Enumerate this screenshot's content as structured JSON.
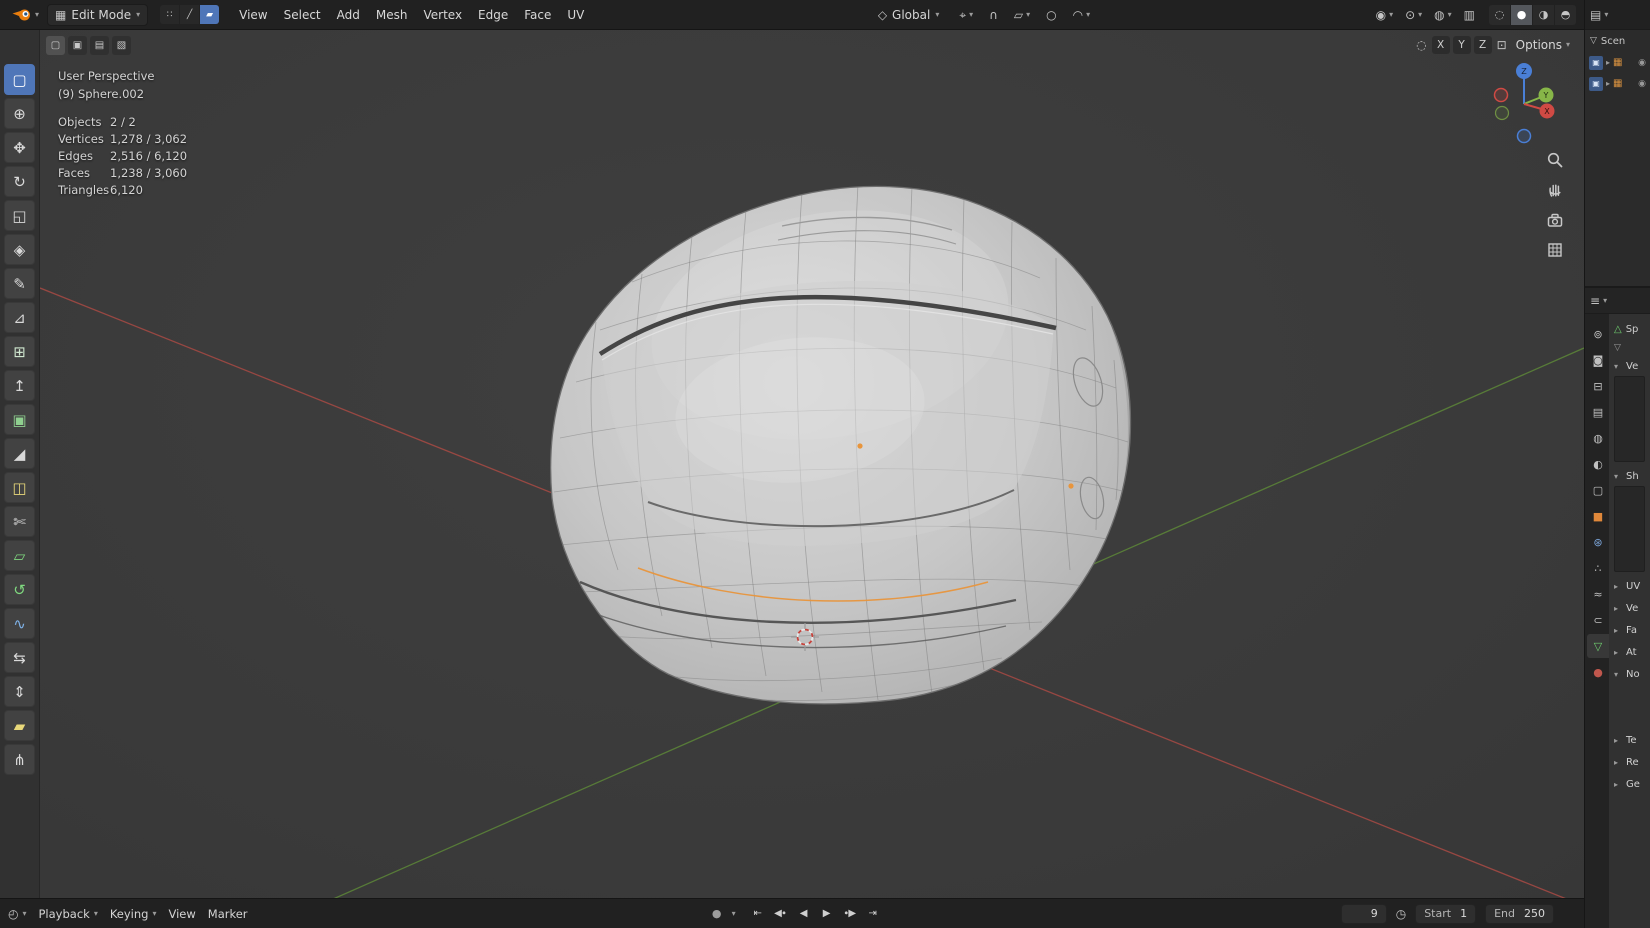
{
  "colors": {
    "accent_blue": "#4f76b8",
    "select_orange": "#e8953c",
    "axis_x_red": "#a84a44",
    "axis_y_green": "#6a9d3e",
    "gizmo_x": "#d04a44",
    "gizmo_y": "#87b648",
    "gizmo_z": "#4a7fd6",
    "helmet_gray": "#c9c9c9"
  },
  "topbar": {
    "mode": {
      "icon": "▦",
      "label": "Edit Mode",
      "caret": "▾"
    },
    "logo_caret": "▾",
    "select_modes": [
      {
        "name": "vertex-select-button",
        "glyph": "∷"
      },
      {
        "name": "edge-select-button",
        "glyph": "╱"
      },
      {
        "name": "face-select-button",
        "glyph": "▰",
        "active": true
      }
    ],
    "menus": [
      {
        "name": "menu-view",
        "label": "View"
      },
      {
        "name": "menu-select",
        "label": "Select"
      },
      {
        "name": "menu-add",
        "label": "Add"
      },
      {
        "name": "menu-mesh",
        "label": "Mesh"
      },
      {
        "name": "menu-vertex",
        "label": "Vertex"
      },
      {
        "name": "menu-edge",
        "label": "Edge"
      },
      {
        "name": "menu-face",
        "label": "Face"
      },
      {
        "name": "menu-uv",
        "label": "UV"
      }
    ],
    "orientation": {
      "icon": "◇",
      "label": "Global",
      "caret": "▾"
    },
    "pivot": {
      "icon": "⌖",
      "caret": "▾"
    },
    "snap": {
      "magnet_icon": "∩",
      "target_icon": "▱",
      "caret": "▾"
    },
    "proportional": {
      "icon": "○",
      "falloff_icon": "◠",
      "caret": "▾"
    },
    "right_toggles": [
      {
        "name": "object-type-visibility-dropdown",
        "glyph": "◉",
        "caret": "▾"
      },
      {
        "name": "gizmos-toggle",
        "glyph": "⊙",
        "caret": "▾"
      },
      {
        "name": "overlays-toggle",
        "glyph": "◍",
        "caret": "▾"
      },
      {
        "name": "xray-toggle",
        "glyph": "▥"
      }
    ],
    "shading_modes": [
      {
        "name": "shading-wireframe-button",
        "glyph": "◌"
      },
      {
        "name": "shading-solid-button",
        "glyph": "●",
        "active": true
      },
      {
        "name": "shading-material-button",
        "glyph": "◑"
      },
      {
        "name": "shading-rendered-button",
        "glyph": "◓"
      }
    ]
  },
  "tool_rail": [
    {
      "name": "tool-select-box",
      "glyph": "▢",
      "active": true
    },
    {
      "name": "tool-cursor",
      "glyph": "⊕"
    },
    {
      "name": "tool-move",
      "glyph": "✥"
    },
    {
      "name": "tool-rotate",
      "glyph": "↻"
    },
    {
      "name": "tool-scale",
      "glyph": "◱"
    },
    {
      "name": "tool-transform",
      "glyph": "◈"
    },
    {
      "name": "tool-annotate",
      "glyph": "✎"
    },
    {
      "name": "tool-measure",
      "glyph": "⊿"
    },
    {
      "name": "tool-add-cube",
      "glyph": "⊞",
      "color": "#cfe6cf"
    },
    {
      "name": "tool-extrude-region",
      "glyph": "↥"
    },
    {
      "name": "tool-inset-faces",
      "glyph": "▣",
      "color": "#8fcf8f"
    },
    {
      "name": "tool-bevel",
      "glyph": "◢"
    },
    {
      "name": "tool-loop-cut",
      "glyph": "◫",
      "color": "#e8d87a"
    },
    {
      "name": "tool-knife",
      "glyph": "✄"
    },
    {
      "name": "tool-poly-build",
      "glyph": "▱",
      "color": "#7fd87f"
    },
    {
      "name": "tool-spin",
      "glyph": "↺",
      "color": "#7fd87f"
    },
    {
      "name": "tool-smooth",
      "glyph": "∿",
      "color": "#7fb2e8"
    },
    {
      "name": "tool-edge-slide",
      "glyph": "⇆"
    },
    {
      "name": "tool-shrink-fatten",
      "glyph": "⇕"
    },
    {
      "name": "tool-shear",
      "glyph": "▰",
      "color": "#e8d87a"
    },
    {
      "name": "tool-rip-region",
      "glyph": "⋔"
    }
  ],
  "viewport": {
    "tool_options": [
      {
        "name": "select-set-new-button",
        "glyph": "▢",
        "active": true
      },
      {
        "name": "select-extend-button",
        "glyph": "▣"
      },
      {
        "name": "select-subtract-button",
        "glyph": "▤"
      },
      {
        "name": "select-intersect-button",
        "glyph": "▧"
      }
    ],
    "header_right": {
      "orbit_icon": "◌",
      "axes": [
        {
          "name": "axis-x-button",
          "label": "X"
        },
        {
          "name": "axis-y-button",
          "label": "Y"
        },
        {
          "name": "axis-z-button",
          "label": "Z"
        }
      ],
      "pan_icon": "⊡",
      "options_label": "Options",
      "caret": "▾"
    },
    "overlay": {
      "view_name": "User Perspective",
      "active_object": "(9) Sphere.002",
      "stats": [
        {
          "label": "Objects",
          "value": "2 / 2"
        },
        {
          "label": "Vertices",
          "value": "1,278 / 3,062"
        },
        {
          "label": "Edges",
          "value": "2,516 / 6,120"
        },
        {
          "label": "Faces",
          "value": "1,238 / 3,060"
        },
        {
          "label": "Triangles",
          "value": "6,120"
        }
      ]
    },
    "gizmo_axes": {
      "x": "X",
      "y": "Y",
      "z": "Z"
    }
  },
  "outliner": {
    "editor_icon": "▤",
    "caret": "▾",
    "filter_icon": "▽",
    "scene_text": "Scen",
    "rows": [
      {
        "name": "outliner-collection-row-1",
        "expand": "▸",
        "coll_icon": "▦",
        "vis_icon": "◉",
        "chip_icon": "▣"
      },
      {
        "name": "outliner-collection-row-2",
        "expand": "▸",
        "coll_icon": "▦",
        "vis_icon": "◉",
        "chip_icon": "▣"
      }
    ]
  },
  "properties": {
    "editor_icon": "≡",
    "caret": "▾",
    "breadcrumb_icon": "△",
    "breadcrumb_text": "Sp",
    "filter_icon": "▽",
    "tabs": [
      {
        "name": "tab-tool",
        "glyph": "⊚"
      },
      {
        "name": "tab-render",
        "glyph": "◙"
      },
      {
        "name": "tab-output",
        "glyph": "⊟"
      },
      {
        "name": "tab-view-layer",
        "glyph": "▤"
      },
      {
        "name": "tab-scene",
        "glyph": "◍"
      },
      {
        "name": "tab-world",
        "glyph": "◐"
      },
      {
        "name": "tab-collection",
        "glyph": "▢"
      },
      {
        "name": "tab-object",
        "glyph": "■",
        "color": "#e0883a"
      },
      {
        "name": "tab-modifiers",
        "glyph": "⊛",
        "color": "#7ba4d8"
      },
      {
        "name": "tab-particles",
        "glyph": "∴"
      },
      {
        "name": "tab-physics",
        "glyph": "≈"
      },
      {
        "name": "tab-constraints",
        "glyph": "⊂"
      },
      {
        "name": "tab-object-data",
        "glyph": "▽",
        "color": "#6fcf6f",
        "active": true
      },
      {
        "name": "tab-material",
        "glyph": "●",
        "color": "#c0574d"
      }
    ],
    "panels": [
      {
        "name": "panel-vertex-groups",
        "chevron": "▾",
        "label": "Ve",
        "has_list": true
      },
      {
        "name": "panel-shape-keys",
        "chevron": "▾",
        "label": "Sh",
        "has_list": true
      },
      {
        "name": "panel-uv-maps",
        "chevron": "▸",
        "label": "UV"
      },
      {
        "name": "panel-color-attributes",
        "chevron": "▸",
        "label": "Ve"
      },
      {
        "name": "panel-face-maps",
        "chevron": "▸",
        "label": "Fa"
      },
      {
        "name": "panel-attributes",
        "chevron": "▸",
        "label": "At"
      },
      {
        "name": "panel-normals",
        "chevron": "▾",
        "label": "No",
        "has_block": true
      },
      {
        "name": "panel-texture-space",
        "chevron": "▸",
        "label": "Te"
      },
      {
        "name": "panel-remesh",
        "chevron": "▸",
        "label": "Re"
      },
      {
        "name": "panel-geometry-data",
        "chevron": "▸",
        "label": "Ge"
      }
    ]
  },
  "timeline": {
    "editor_icon": "◴",
    "caret": "▾",
    "menus": [
      {
        "name": "playback-menu",
        "label": "Playback",
        "caret": "▾"
      },
      {
        "name": "keying-menu",
        "label": "Keying",
        "caret": "▾"
      },
      {
        "name": "view-menu",
        "label": "View"
      },
      {
        "name": "marker-menu",
        "label": "Marker"
      }
    ],
    "record_icon": "●",
    "record_caret": "▾",
    "transport": [
      {
        "name": "jump-to-start-button",
        "glyph": "⇤"
      },
      {
        "name": "prev-keyframe-button",
        "glyph": "◀∙"
      },
      {
        "name": "play-reverse-button",
        "glyph": "◀"
      },
      {
        "name": "play-button",
        "glyph": "▶"
      },
      {
        "name": "next-keyframe-button",
        "glyph": "∙▶"
      },
      {
        "name": "jump-to-end-button",
        "glyph": "⇥"
      }
    ],
    "frame_current": "9",
    "clock_icon": "◷",
    "start_label": "Start",
    "start_value": "1",
    "end_label": "End",
    "end_value": "250"
  }
}
